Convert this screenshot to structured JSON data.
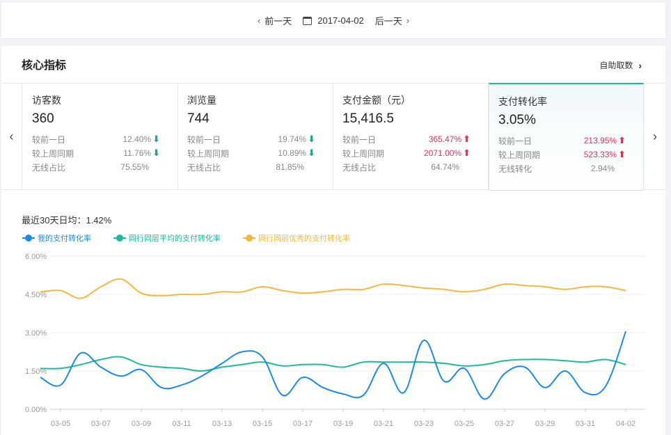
{
  "datebar": {
    "prev": "前一天",
    "date": "2017-04-02",
    "next": "后一天"
  },
  "section": {
    "title": "核心指标",
    "self_fetch": "自助取数"
  },
  "metrics": [
    {
      "name": "访客数",
      "value": "360",
      "rows": [
        {
          "label": "较前一日",
          "val": "12.40%",
          "dir": "down"
        },
        {
          "label": "较上周同期",
          "val": "11.76%",
          "dir": "down"
        },
        {
          "label": "无线占比",
          "val": "75.55%",
          "dir": ""
        }
      ]
    },
    {
      "name": "浏览量",
      "value": "744",
      "rows": [
        {
          "label": "较前一日",
          "val": "19.74%",
          "dir": "down"
        },
        {
          "label": "较上周同期",
          "val": "10.89%",
          "dir": "down"
        },
        {
          "label": "无线占比",
          "val": "81.85%",
          "dir": ""
        }
      ]
    },
    {
      "name": "支付金额（元）",
      "value": "15,416.5",
      "rows": [
        {
          "label": "较前一日",
          "val": "365.47%",
          "dir": "up"
        },
        {
          "label": "较上周同期",
          "val": "2071.00%",
          "dir": "up"
        },
        {
          "label": "无线占比",
          "val": "64.74%",
          "dir": ""
        }
      ]
    },
    {
      "name": "支付转化率",
      "value": "3.05%",
      "rows": [
        {
          "label": "较前一日",
          "val": "213.95%",
          "dir": "up"
        },
        {
          "label": "较上周同期",
          "val": "523.33%",
          "dir": "up"
        },
        {
          "label": "无线转化",
          "val": "2.94%",
          "dir": ""
        }
      ]
    }
  ],
  "avg_text": "最近30天日均：1.42%",
  "colors": {
    "mine": "#1a8ae8",
    "peer_avg": "#1abc9c",
    "peer_best": "#f5b83d",
    "up": "#e1335a",
    "down": "#1aa98a"
  },
  "chart_data": {
    "type": "line",
    "y_ticks": [
      "6.00%",
      "4.50%",
      "3.00%",
      "1.50%",
      "0.00%"
    ],
    "ylim": [
      0,
      6
    ],
    "x_tick_labels": [
      "03-05",
      "03-07",
      "03-09",
      "03-11",
      "03-13",
      "03-15",
      "03-17",
      "03-19",
      "03-21",
      "03-23",
      "03-25",
      "03-27",
      "03-29",
      "03-31",
      "04-02"
    ],
    "x": [
      "03-04",
      "03-05",
      "03-06",
      "03-07",
      "03-08",
      "03-09",
      "03-10",
      "03-11",
      "03-12",
      "03-13",
      "03-14",
      "03-15",
      "03-16",
      "03-17",
      "03-18",
      "03-19",
      "03-20",
      "03-21",
      "03-22",
      "03-23",
      "03-24",
      "03-25",
      "03-26",
      "03-27",
      "03-28",
      "03-29",
      "03-30",
      "03-31",
      "04-01",
      "04-02"
    ],
    "series": [
      {
        "name": "我的支付转化率",
        "color": "#1a8ae8",
        "values": [
          1.25,
          0.95,
          2.2,
          1.65,
          1.3,
          1.55,
          0.85,
          0.95,
          1.3,
          1.8,
          2.25,
          2.05,
          0.55,
          1.25,
          0.85,
          0.6,
          0.55,
          1.8,
          0.65,
          2.7,
          1.1,
          1.6,
          0.4,
          1.4,
          1.65,
          0.85,
          1.5,
          0.65,
          0.9,
          3.05
        ]
      },
      {
        "name": "同行同层平均的支付转化率",
        "color": "#1abc9c",
        "values": [
          1.6,
          1.6,
          1.75,
          1.95,
          2.05,
          1.75,
          1.65,
          1.6,
          1.5,
          1.65,
          1.75,
          1.85,
          1.7,
          1.75,
          1.75,
          1.65,
          1.85,
          1.85,
          1.85,
          1.85,
          1.8,
          1.7,
          1.75,
          1.9,
          1.95,
          1.95,
          1.9,
          1.85,
          1.95,
          1.75
        ]
      },
      {
        "name": "同行同层优秀的支付转化率",
        "color": "#f5b83d",
        "values": [
          4.6,
          4.65,
          4.35,
          4.8,
          5.1,
          4.55,
          4.45,
          4.5,
          4.5,
          4.6,
          4.6,
          4.8,
          4.65,
          4.55,
          4.6,
          4.7,
          4.7,
          4.9,
          4.85,
          4.75,
          4.7,
          4.6,
          4.7,
          4.9,
          4.85,
          4.8,
          4.7,
          4.8,
          4.8,
          4.65
        ]
      }
    ]
  }
}
